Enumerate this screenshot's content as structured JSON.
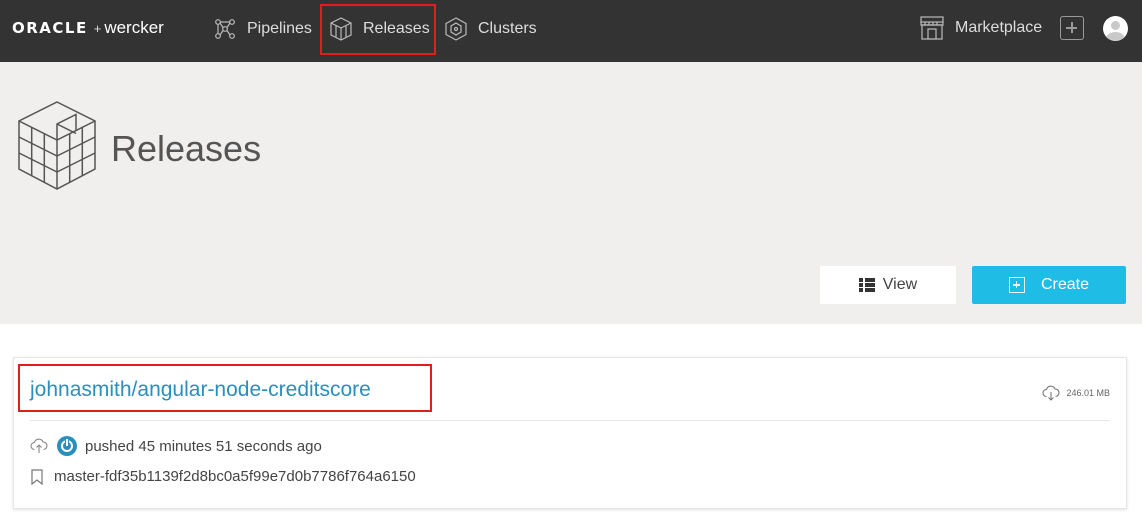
{
  "nav": {
    "brand_oracle": "ORACLE",
    "brand_plus": "+",
    "brand_wercker": "wercker",
    "pipelines": "Pipelines",
    "releases": "Releases",
    "clusters": "Clusters",
    "marketplace": "Marketplace"
  },
  "header": {
    "title": "Releases"
  },
  "actions": {
    "view": "View",
    "create": "Create"
  },
  "release": {
    "repo": "johnasmith/angular-node-creditscore",
    "size": "246.01 MB",
    "pushed": "pushed 45 minutes 51 seconds ago",
    "tag": "master-fdf35b1139f2d8bc0a5f99e7d0b7786f764a6150"
  },
  "colors": {
    "topbar": "#333333",
    "accent": "#1fbde6",
    "link": "#2a8fbd",
    "highlight": "#e31c1c"
  }
}
